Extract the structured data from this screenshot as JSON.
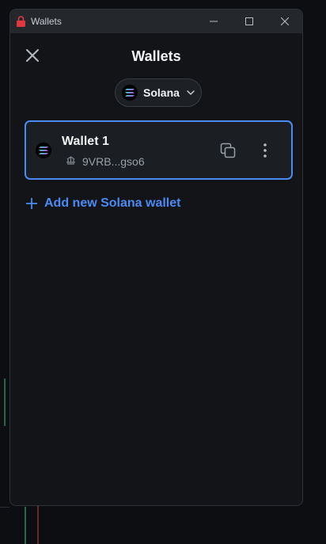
{
  "window": {
    "title": "Wallets",
    "controls": {
      "minimize_icon": "minimize-icon",
      "maximize_icon": "maximize-icon",
      "close_icon": "close-icon"
    }
  },
  "panel": {
    "title": "Wallets",
    "close_icon": "close-icon"
  },
  "chain_selector": {
    "selected": "Solana",
    "icon": "solana-icon"
  },
  "wallets": [
    {
      "name": "Wallet 1",
      "address": "9VRB...gso6",
      "address_icon": "vault-icon",
      "actions": [
        "copy-icon",
        "more-vertical-icon"
      ]
    }
  ],
  "add_wallet": {
    "label": "Add new Solana wallet",
    "icon": "plus-icon"
  },
  "colors": {
    "accent": "#4a8af4",
    "background": "#121417",
    "titlebar": "#24282d",
    "card": "#1b1e22",
    "app_icon": "#e0383e"
  }
}
